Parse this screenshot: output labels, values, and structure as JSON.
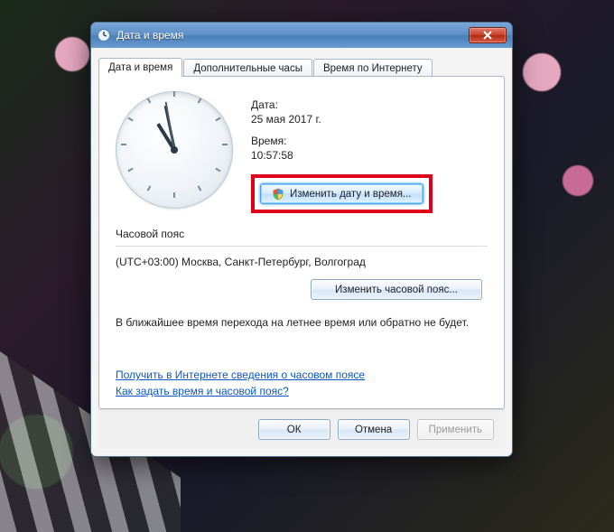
{
  "window": {
    "title": "Дата и время"
  },
  "tabs": [
    {
      "label": "Дата и время"
    },
    {
      "label": "Дополнительные часы"
    },
    {
      "label": "Время по Интернету"
    }
  ],
  "datetime": {
    "date_label": "Дата:",
    "date_value": "25 мая 2017 г.",
    "time_label": "Время:",
    "time_value": "10:57:58",
    "change_button": "Изменить дату и время..."
  },
  "timezone": {
    "section_label": "Часовой пояс",
    "value": "(UTC+03:00) Москва, Санкт-Петербург, Волгоград",
    "change_button": "Изменить часовой пояс..."
  },
  "dst_note": "В ближайшее время перехода на летнее время или обратно не будет.",
  "links": {
    "info": "Получить в Интернете сведения о часовом поясе",
    "howto": "Как задать время и часовой пояс?"
  },
  "buttons": {
    "ok": "ОК",
    "cancel": "Отмена",
    "apply": "Применить"
  }
}
